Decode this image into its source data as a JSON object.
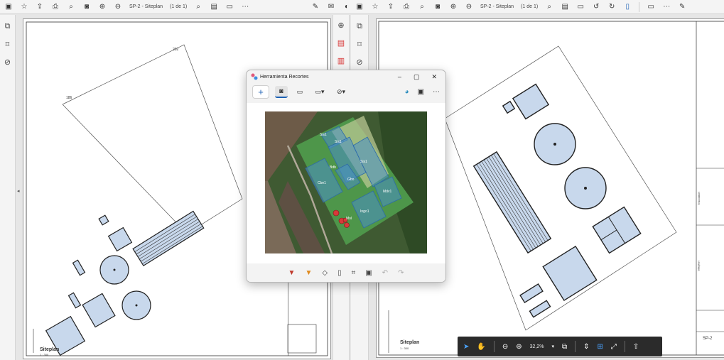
{
  "left_window": {
    "toolbar_icons": [
      "save-icon",
      "star-icon",
      "upload-icon",
      "print-icon",
      "zoom-search-icon",
      "camera-icon",
      "arrow-up-icon",
      "arrow-down-icon"
    ],
    "document_label": "SP-2 - Siteplan",
    "page_counter": "(1 de 1)",
    "plan": {
      "title": "Siteplan",
      "scale": "1 : 300",
      "property_label_top": "202",
      "property_label_left": "186"
    }
  },
  "right_window": {
    "document_label": "SP-2 - Siteplan",
    "page_counter": "(1 de 1)",
    "plan": {
      "title": "Siteplan",
      "scale": "1 : 300",
      "sheet_number": "SP-2",
      "sheet_label_1": "Siteplan",
      "sheet_label_2": "Tracciatori"
    }
  },
  "snipping_tool": {
    "title": "Herramienta Recortes",
    "new_label": "+",
    "map_labels": [
      "Sis1",
      "Sis1",
      "Bdb",
      "Sis1",
      "Cbe1",
      "Gbo",
      "Mdv1",
      "Ingo1",
      "Mol"
    ]
  },
  "zoom_bar": {
    "zoom_value": "32,2%"
  },
  "colors": {
    "toolbar_bg": "#f4f4f4",
    "accent_blue": "#1a5fb4",
    "acrobat_red": "#d62f2f",
    "building_fill": "#c8d8ec",
    "zoombar_bg": "#2b2b2b"
  }
}
